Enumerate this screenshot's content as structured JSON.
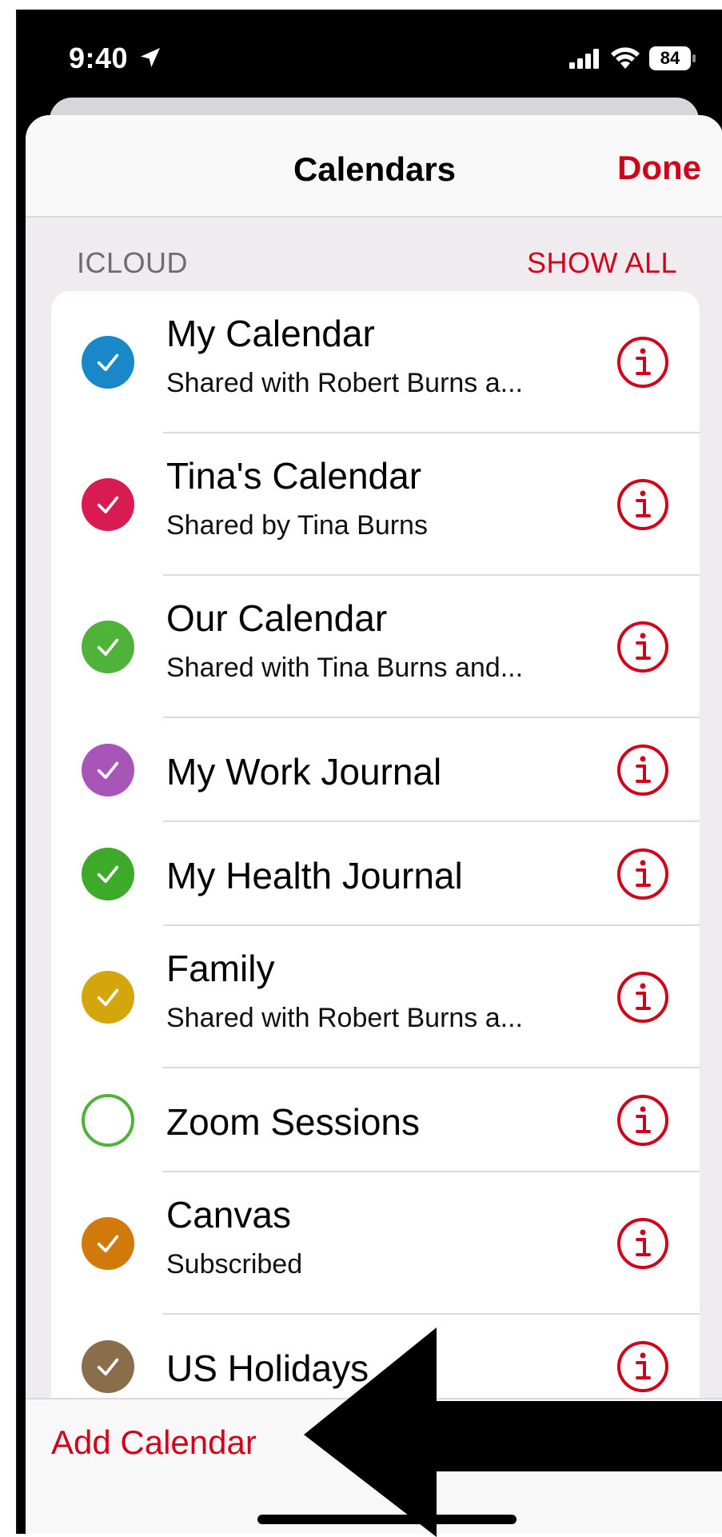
{
  "status_bar": {
    "time": "9:40",
    "battery": "84"
  },
  "nav": {
    "title": "Calendars",
    "done_label": "Done"
  },
  "section": {
    "header": "ICLOUD",
    "show_all_label": "SHOW ALL"
  },
  "calendars": [
    {
      "title": "My Calendar",
      "subtitle": "Shared with Robert Burns a...",
      "color": "#1a87c8",
      "checked": true
    },
    {
      "title": "Tina's Calendar",
      "subtitle": "Shared by Tina Burns",
      "color": "#d81b52",
      "checked": true
    },
    {
      "title": "Our Calendar",
      "subtitle": "Shared with Tina Burns and...",
      "color": "#4fb33a",
      "checked": true
    },
    {
      "title": "My Work Journal",
      "subtitle": "",
      "color": "#a855b8",
      "checked": true
    },
    {
      "title": "My Health Journal",
      "subtitle": "",
      "color": "#3daa2a",
      "checked": true
    },
    {
      "title": "Family",
      "subtitle": "Shared with Robert Burns a...",
      "color": "#d2a60c",
      "checked": true
    },
    {
      "title": "Zoom Sessions",
      "subtitle": "",
      "color": "#4fb33a",
      "checked": false
    },
    {
      "title": "Canvas",
      "subtitle": "Subscribed",
      "color": "#d17a0b",
      "checked": true
    },
    {
      "title": "US Holidays",
      "subtitle": "",
      "color": "#8a6d4a",
      "checked": true
    }
  ],
  "bottom": {
    "add_calendar_label": "Add Calendar"
  },
  "colors": {
    "accent": "#d0021b",
    "sheet_background": "#efebee"
  }
}
